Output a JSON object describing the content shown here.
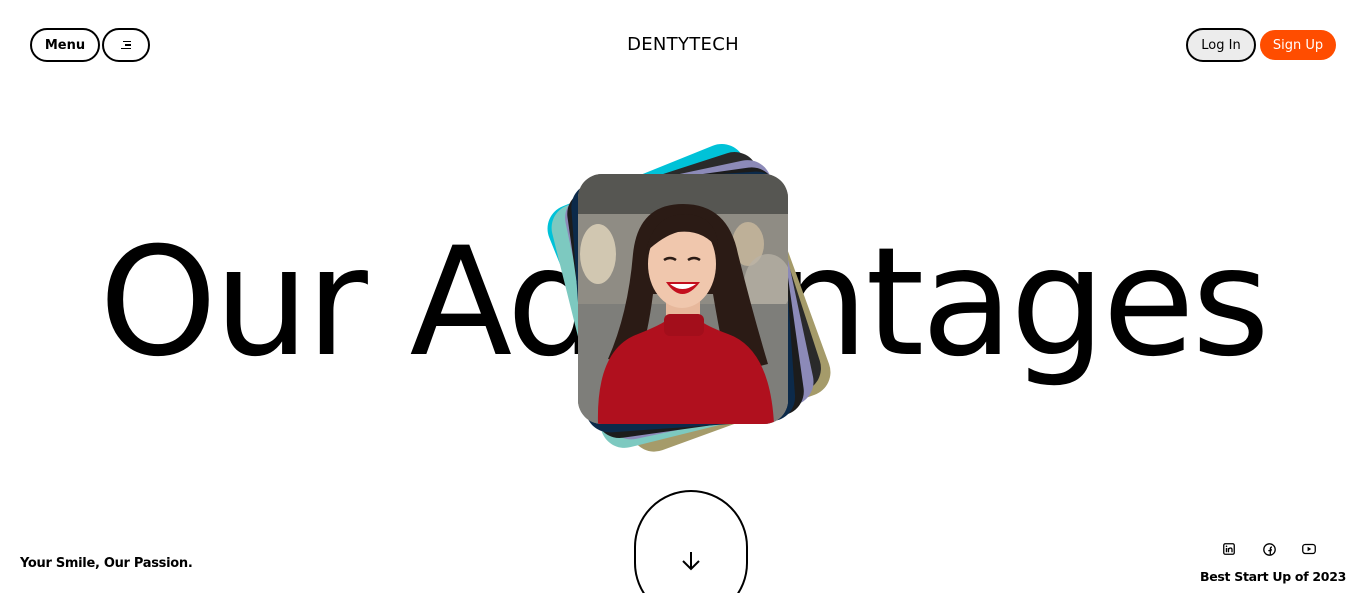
{
  "header": {
    "menu_label": "Menu",
    "menu_icon": "hamburger-icon",
    "brand": "DENTYTECH",
    "login_label": "Log In",
    "signup_label": "Sign Up"
  },
  "hero": {
    "title": "Our Advantages",
    "photo_alt": "Smiling woman in red sweater"
  },
  "footer": {
    "tagline": "Your Smile, Our Passion.",
    "award": "Best Start Up of 2023",
    "socials": [
      "linkedin-icon",
      "facebook-icon",
      "youtube-icon"
    ]
  },
  "colors": {
    "accent": "#ff4d00",
    "card_colors": [
      "#00c2d8",
      "#2a2a2a",
      "#8c8ab8",
      "#7dc9c0",
      "#a59b6a",
      "#1c1c1c"
    ]
  }
}
